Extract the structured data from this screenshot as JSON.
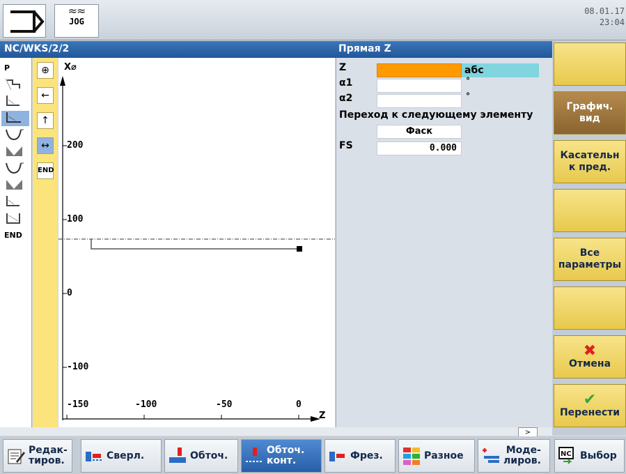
{
  "header": {
    "mode_label": "JOG",
    "date": "08.01.17",
    "time": "23:04"
  },
  "path": {
    "title": "NC/WKS/2/2",
    "element_title": "Прямая Z"
  },
  "left_icons": [
    {
      "name": "program-header-icon",
      "text": "P"
    },
    {
      "name": "contour-icon-1",
      "text": ""
    },
    {
      "name": "contour-icon-2",
      "text": ""
    },
    {
      "name": "contour-icon-3",
      "text": ""
    },
    {
      "name": "contour-icon-4",
      "text": ""
    },
    {
      "name": "contour-icon-5",
      "text": ""
    },
    {
      "name": "contour-icon-6",
      "text": ""
    },
    {
      "name": "contour-icon-7",
      "text": ""
    },
    {
      "name": "contour-icon-8",
      "text": ""
    },
    {
      "name": "contour-icon-9",
      "text": ""
    },
    {
      "name": "end-label",
      "text": "END"
    }
  ],
  "direction_buttons": [
    {
      "glyph": "⊕"
    },
    {
      "glyph": "←"
    },
    {
      "glyph": "↑"
    },
    {
      "glyph": "↔"
    },
    {
      "glyph": "END"
    }
  ],
  "graphic": {
    "x_axis_label": "X⌀",
    "z_axis_label": "Z",
    "x_ticks": [
      "200",
      "100",
      "0",
      "-100"
    ],
    "z_ticks": [
      "-150",
      "-100",
      "-50",
      "0"
    ]
  },
  "form": {
    "z_label": "Z",
    "z_value": "",
    "z_mode": "абс",
    "a1_label": "α1",
    "a1_value": "",
    "a1_unit": "°",
    "a2_label": "α2",
    "a2_value": "",
    "a2_unit": "°",
    "transition_label": "Переход к следующему элементу",
    "transition_value": "Фаск",
    "fs_label": "FS",
    "fs_value": "0.000"
  },
  "right_softkeys": [
    {
      "id": "rk1",
      "lines": [
        "",
        ""
      ]
    },
    {
      "id": "rk2",
      "lines": [
        "Графич.",
        "вид"
      ]
    },
    {
      "id": "rk3",
      "lines": [
        "Касательн",
        "к пред."
      ]
    },
    {
      "id": "rk4",
      "lines": [
        "",
        ""
      ]
    },
    {
      "id": "rk5",
      "lines": [
        "Все",
        "параметры"
      ]
    },
    {
      "id": "rk6",
      "lines": [
        "",
        ""
      ]
    },
    {
      "id": "rk7",
      "lines": [
        "Отмена",
        ""
      ]
    },
    {
      "id": "rk8",
      "lines": [
        "Перенести",
        ""
      ]
    }
  ],
  "bottom_softkeys": [
    {
      "l1": "Редак-",
      "l2": "тиров."
    },
    {
      "l1": "Сверл.",
      "l2": ""
    },
    {
      "l1": "Обточ.",
      "l2": ""
    },
    {
      "l1": "Обточ.",
      "l2": "конт."
    },
    {
      "l1": "Фрез.",
      "l2": ""
    },
    {
      "l1": "Разное",
      "l2": ""
    },
    {
      "l1": "Моде-",
      "l2": "лиров."
    },
    {
      "l1": "Выбор",
      "l2": ""
    }
  ],
  "scroll_more": ">",
  "colors": {
    "accent_blue": "#22579a",
    "softkey_yellow": "#f0d86a",
    "field_active": "#ff9a00",
    "mode_cyan": "#80d5de",
    "cancel_red": "#e02020",
    "accept_green": "#3aa33a"
  }
}
